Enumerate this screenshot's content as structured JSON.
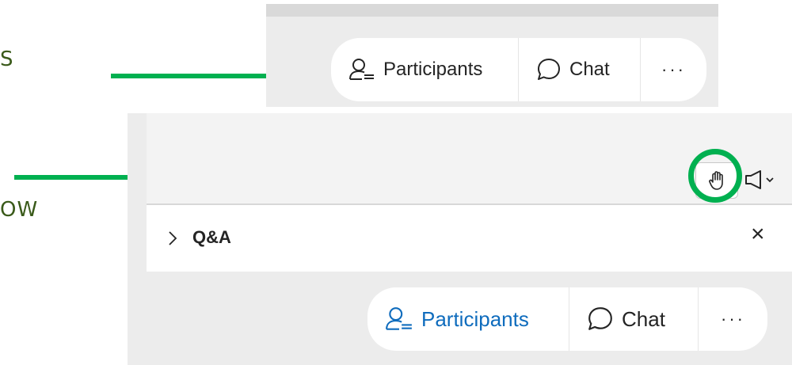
{
  "side_texts": [
    "S",
    "OW"
  ],
  "top_toolbar": {
    "participants_label": "Participants",
    "chat_label": "Chat",
    "more_label": "···"
  },
  "panel": {
    "qa_title": "Q&A",
    "close_label": "×"
  },
  "bottom_toolbar": {
    "participants_label": "Participants",
    "chat_label": "Chat",
    "more_label": "···"
  },
  "colors": {
    "arrow_green": "#00b050",
    "participants_active_blue": "#0f6cbd",
    "side_text_green": "#3a5a1a"
  },
  "icons": [
    "participants-icon",
    "chat-icon",
    "raise-hand-icon",
    "announcement-icon",
    "chevron-right-icon",
    "close-icon"
  ]
}
